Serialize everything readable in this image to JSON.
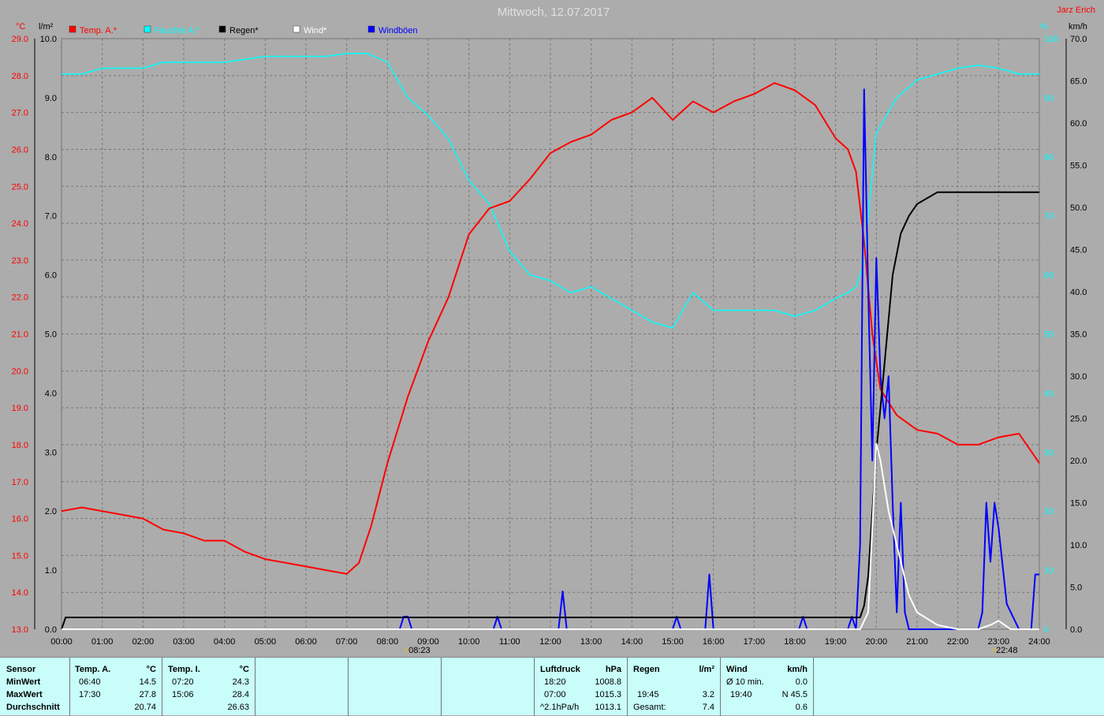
{
  "title": "Mittwoch, 12.07.2017",
  "author": "Jarz Erich",
  "legend": [
    {
      "label": "Temp. A.*",
      "color": "#ff0000"
    },
    {
      "label": "Feuchte A.*",
      "color": "#00ffff"
    },
    {
      "label": "Regen*",
      "color": "#000000"
    },
    {
      "label": "Wind*",
      "color": "#ffffff"
    },
    {
      "label": "Windböen",
      "color": "#0000ff"
    }
  ],
  "axes": {
    "temp_unit": "°C",
    "rain_unit": "l/m²",
    "hum_unit": "%",
    "wind_unit": "km/h",
    "temp_ticks": [
      "29.0",
      "28.0",
      "27.0",
      "26.0",
      "25.0",
      "24.0",
      "23.0",
      "22.0",
      "21.0",
      "20.0",
      "19.0",
      "18.0",
      "17.0",
      "16.0",
      "15.0",
      "14.0",
      "13.0"
    ],
    "rain_ticks": [
      "10.0",
      "9.0",
      "8.0",
      "7.0",
      "6.0",
      "5.0",
      "4.0",
      "3.0",
      "2.0",
      "1.0",
      "0.0"
    ],
    "hum_ticks": [
      "100",
      "90",
      "80",
      "70",
      "60",
      "50",
      "40",
      "30",
      "20",
      "10",
      "0"
    ],
    "wind_ticks": [
      "70.0",
      "65.0",
      "60.0",
      "55.0",
      "50.0",
      "45.0",
      "40.0",
      "35.0",
      "30.0",
      "25.0",
      "20.0",
      "15.0",
      "10.0",
      "5.0",
      "0.0"
    ],
    "time_ticks": [
      "00:00",
      "01:00",
      "02:00",
      "03:00",
      "04:00",
      "05:00",
      "06:00",
      "07:00",
      "08:00",
      "09:00",
      "10:00",
      "11:00",
      "12:00",
      "13:00",
      "14:00",
      "15:00",
      "16:00",
      "17:00",
      "18:00",
      "19:00",
      "20:00",
      "21:00",
      "22:00",
      "23:00",
      "24:00"
    ],
    "marker_left": "08:23",
    "marker_right": "22:48"
  },
  "chart_data": {
    "type": "line",
    "x_unit": "hour",
    "xlim": [
      0,
      24
    ],
    "grid": true,
    "series": [
      {
        "name": "Temp. A.*",
        "axis": "°C",
        "ylim": [
          13,
          29
        ],
        "x": [
          0,
          0.5,
          1,
          1.5,
          2,
          2.5,
          3,
          3.5,
          4,
          4.5,
          5,
          5.5,
          6,
          6.5,
          7,
          7.3,
          7.6,
          8,
          8.5,
          9,
          9.5,
          10,
          10.5,
          11,
          11.5,
          12,
          12.5,
          13,
          13.5,
          14,
          14.5,
          15,
          15.5,
          16,
          16.5,
          17,
          17.5,
          18,
          18.5,
          19,
          19.3,
          19.5,
          19.7,
          19.9,
          20.1,
          20.5,
          21,
          21.5,
          22,
          22.5,
          23,
          23.5,
          24
        ],
        "values": [
          16.2,
          16.3,
          16.2,
          16.1,
          16.0,
          15.7,
          15.6,
          15.4,
          15.4,
          15.1,
          14.9,
          14.8,
          14.7,
          14.6,
          14.5,
          14.8,
          15.8,
          17.5,
          19.3,
          20.8,
          22.0,
          23.7,
          24.4,
          24.6,
          25.2,
          25.9,
          26.2,
          26.4,
          26.8,
          27.0,
          27.4,
          26.8,
          27.3,
          27.0,
          27.3,
          27.5,
          27.8,
          27.6,
          27.2,
          26.3,
          26.0,
          25.4,
          23.5,
          21.0,
          19.5,
          18.8,
          18.4,
          18.3,
          18.0,
          18.0,
          18.2,
          18.3,
          17.5
        ]
      },
      {
        "name": "Feuchte A.*",
        "axis": "%",
        "ylim": [
          0,
          100
        ],
        "x": [
          0,
          0.5,
          1,
          1.5,
          2,
          2.5,
          3,
          3.5,
          4,
          4.5,
          5,
          5.5,
          6,
          6.5,
          7,
          7.5,
          8,
          8.5,
          9,
          9.5,
          10,
          10.5,
          11,
          11.5,
          12,
          12.5,
          13,
          13.5,
          14,
          14.5,
          15,
          15.5,
          16,
          16.5,
          17,
          17.5,
          18,
          18.5,
          19,
          19.3,
          19.5,
          19.7,
          19.8,
          20,
          20.5,
          21,
          21.5,
          22,
          22.5,
          23,
          23.5,
          24
        ],
        "values": [
          94,
          94,
          95,
          95,
          95,
          96,
          96,
          96,
          96,
          96.5,
          97,
          97,
          97,
          97,
          97.5,
          97.5,
          96,
          90,
          87,
          83,
          76,
          72,
          64,
          60,
          59,
          57,
          58,
          56,
          54,
          52,
          51,
          57,
          54,
          54,
          54,
          54,
          53,
          54,
          56,
          57,
          58,
          62,
          70,
          84,
          90,
          93,
          94,
          95,
          95.5,
          95,
          94,
          94
        ]
      },
      {
        "name": "Regen*",
        "axis": "l/m²",
        "ylim": [
          0,
          10
        ],
        "x": [
          0,
          0.1,
          0.5,
          1,
          2,
          4,
          6,
          8,
          10,
          12,
          14,
          16,
          18,
          19,
          19.6,
          19.7,
          19.8,
          19.9,
          20,
          20.2,
          20.4,
          20.6,
          20.8,
          21,
          21.5,
          22,
          23,
          24
        ],
        "values": [
          0,
          0.2,
          0.2,
          0.2,
          0.2,
          0.2,
          0.2,
          0.2,
          0.2,
          0.2,
          0.2,
          0.2,
          0.2,
          0.2,
          0.2,
          0.4,
          0.9,
          2.0,
          3.0,
          4.5,
          6.0,
          6.7,
          7.0,
          7.2,
          7.4,
          7.4,
          7.4,
          7.4
        ]
      },
      {
        "name": "Wind*",
        "axis": "km/h",
        "ylim": [
          0,
          70
        ],
        "x": [
          0,
          19.6,
          19.8,
          19.9,
          20,
          20.1,
          20.3,
          20.5,
          20.8,
          21,
          21.5,
          22,
          22.5,
          22.8,
          23,
          23.3,
          24
        ],
        "values": [
          0,
          0,
          2,
          12,
          22,
          20,
          14,
          10,
          4,
          2,
          0.5,
          0,
          0,
          0.5,
          1,
          0,
          0
        ]
      },
      {
        "name": "Windböen",
        "axis": "km/h",
        "ylim": [
          0,
          70
        ],
        "x": [
          0,
          8.3,
          8.4,
          8.5,
          8.6,
          10.6,
          10.7,
          10.8,
          12.2,
          12.3,
          12.4,
          15.0,
          15.1,
          15.2,
          15.8,
          15.9,
          16.0,
          18.1,
          18.2,
          18.3,
          19.3,
          19.4,
          19.5,
          19.6,
          19.7,
          19.8,
          19.9,
          20.0,
          20.1,
          20.2,
          20.3,
          20.4,
          20.5,
          20.6,
          20.7,
          20.8,
          21.0,
          22.5,
          22.6,
          22.7,
          22.8,
          22.9,
          23.0,
          23.2,
          23.5,
          23.8,
          23.9,
          24
        ],
        "values": [
          0,
          0,
          1.5,
          1.5,
          0,
          0,
          1.5,
          0,
          0,
          4.5,
          0,
          0,
          1.5,
          0,
          0,
          6.5,
          0,
          0,
          1.5,
          0,
          0,
          1.5,
          0,
          10,
          64,
          40,
          20,
          44,
          30,
          25,
          30,
          15,
          2,
          15,
          2,
          0,
          0,
          0,
          2,
          15,
          8,
          15,
          12,
          3,
          0,
          0,
          6.5,
          6.5
        ]
      }
    ]
  },
  "stats": {
    "sensor_header": "Sensor",
    "row_labels": [
      "MinWert",
      "MaxWert",
      "Durchschnitt"
    ],
    "temp_a": {
      "header": "Temp. A.",
      "unit": "°C",
      "min_time": "06:40",
      "min_val": "14.5",
      "max_time": "17:30",
      "max_val": "27.8",
      "avg": "20.74"
    },
    "temp_i": {
      "header": "Temp. I.",
      "unit": "°C",
      "min_time": "07:20",
      "min_val": "24.3",
      "max_time": "15:06",
      "max_val": "28.4",
      "avg": "26.63"
    },
    "pressure": {
      "header": "Luftdruck",
      "unit": "hPa",
      "min_time": "18:20",
      "min_val": "1008.8",
      "max_time": "07:00",
      "max_val": "1015.3",
      "trend_label": "^2.1hPa/h",
      "trend_val": "1013.1"
    },
    "rain": {
      "header": "Regen",
      "unit": "l/m²",
      "max_time": "19:45",
      "max_val": "3.2",
      "total_label": "Gesamt:",
      "total_val": "7.4"
    },
    "wind": {
      "header": "Wind",
      "unit": "km/h",
      "avg_label": "Ø 10 min.",
      "avg_val": "0.0",
      "max_time": "19:40",
      "max_val": "N 45.5",
      "mean_val": "0.6"
    }
  }
}
